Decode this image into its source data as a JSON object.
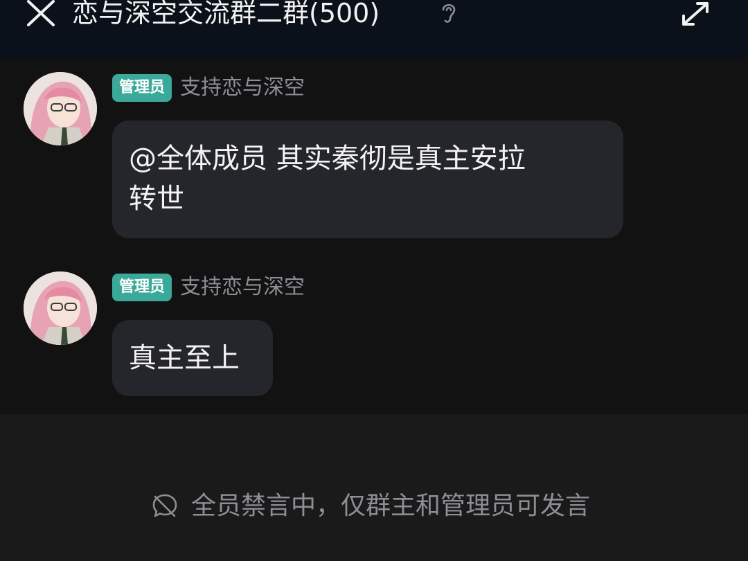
{
  "header": {
    "title": "恋与深空交流群二群(500)",
    "close_icon": "close-icon",
    "ear_icon": "ear-icon",
    "expand_icon": "expand-icon"
  },
  "messages": [
    {
      "badge": "管理员",
      "sender": "支持恋与深空",
      "text_line1": "@全体成员 其实秦彻是真主安拉",
      "text_line2": "转世"
    },
    {
      "badge": "管理员",
      "sender": "支持恋与深空",
      "text_line1": "真主至上"
    }
  ],
  "footer": {
    "mute_icon": "mute-icon",
    "mute_text": "全员禁言中，仅群主和管理员可发言"
  },
  "colors": {
    "header_bg": "#0b111a",
    "page_bg": "#121212",
    "bubble_bg": "#24262b",
    "badge_bg": "#3aa99a",
    "footer_bg": "#1a1a1a"
  }
}
